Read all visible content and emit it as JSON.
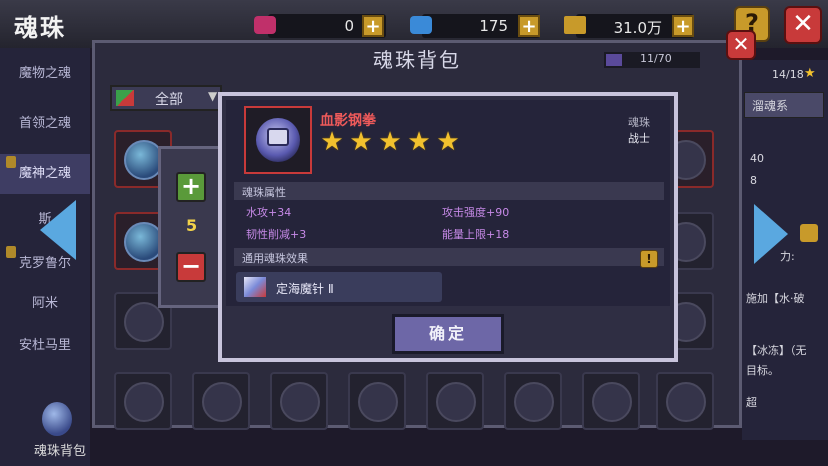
{
  "header": {
    "title": "魂珠",
    "resources": [
      {
        "icon": "pink-gem-icon",
        "value": "0",
        "color": "#c0306a"
      },
      {
        "icon": "blue-gem-icon",
        "value": "175",
        "color": "#3a8ad8"
      },
      {
        "icon": "gold-chest-icon",
        "value": "31.0万",
        "color": "#c89a2a"
      }
    ],
    "help_label": "?",
    "close_label": "✕"
  },
  "sidebar": {
    "items": [
      {
        "label": "魔物之魂"
      },
      {
        "label": "首领之魂"
      },
      {
        "label": "魔神之魂"
      },
      {
        "label": "斯"
      },
      {
        "label": "克罗鲁尔"
      },
      {
        "label": "阿米"
      },
      {
        "label": "安杜马里"
      }
    ],
    "bag_label": "魂珠背包"
  },
  "right_panel": {
    "progress": "14/18",
    "tab_label": "溜魂系",
    "val1": "40",
    "val2": "8",
    "text1": "力:",
    "text2": "施加【水·破",
    "text3": "【冰冻】（无",
    "text4": "目标。",
    "text5": "超"
  },
  "bag_panel": {
    "title": "魂珠背包",
    "capacity": "11/70",
    "capacity_fraction": 0.157,
    "filter_label": "全部"
  },
  "stepper": {
    "plus": "+",
    "minus": "−",
    "quantity": "5"
  },
  "item": {
    "name": "血影钢拳",
    "stars": 5,
    "category": "魂珠",
    "class": "战士",
    "attributes_title": "魂珠属性",
    "attributes": [
      "水攻+34",
      "攻击强度+90",
      "韧性削减+3",
      "能量上限+18"
    ],
    "effect_title": "通用魂珠效果",
    "effect_help": "!",
    "effect_name": "定海魔针 Ⅱ",
    "confirm_label": "确定"
  },
  "colors": {
    "accent": "#6d67a7",
    "item_name": "#ee5a5a",
    "attribute": "#c78ae8",
    "star": "#f2c12e",
    "arrow": "#5aa8e0"
  }
}
